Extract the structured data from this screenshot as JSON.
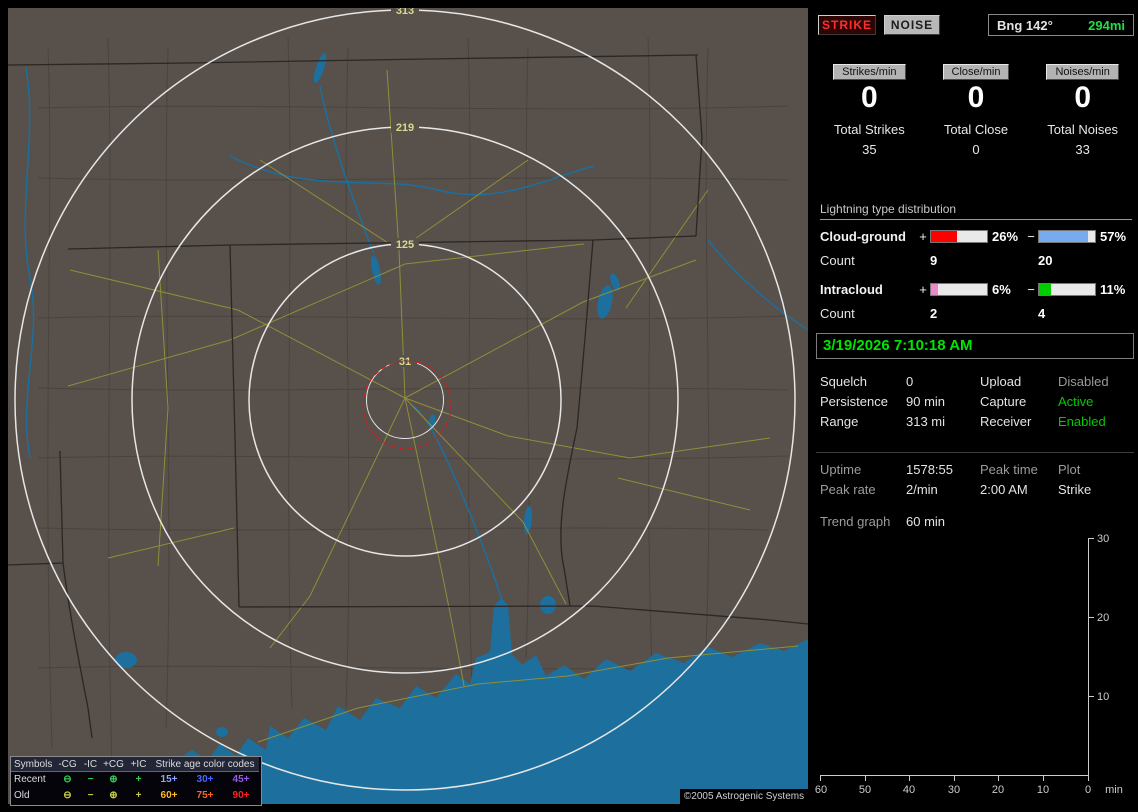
{
  "map": {
    "rings": [
      "313",
      "219",
      "125",
      "31"
    ],
    "copyright": "©2005 Astrogenic Systems",
    "legend": {
      "sym_header": "Symbols",
      "age_header": "Strike age color codes",
      "cols": [
        "-CG",
        "-IC",
        "+CG",
        "+IC"
      ],
      "rows": [
        {
          "label": "Recent",
          "sym_style": "color:#33cc55",
          "s0": "⊖",
          "s1": "−",
          "s2": "⊕",
          "s3": "+",
          "a0": "15+",
          "a0s": "color:#8fa8ff",
          "a1": "30+",
          "a1s": "color:#4a66ff",
          "a2": "45+",
          "a2s": "color:#a055ee"
        },
        {
          "label": "Old",
          "sym_style": "color:#cccc44",
          "s0": "⊖",
          "s1": "−",
          "s2": "⊕",
          "s3": "+",
          "a0": "60+",
          "a0s": "color:#ffbb22",
          "a1": "75+",
          "a1s": "color:#ff6622",
          "a2": "90+",
          "a2s": "color:#ff2222"
        }
      ]
    }
  },
  "header": {
    "strike": "STRIKE",
    "noise": "NOISE",
    "bearing_label": "Bng 142°",
    "bearing_value": "294mi"
  },
  "stats": {
    "columns": [
      {
        "rate_label": "Strikes/min",
        "rate": "0",
        "total_label": "Total Strikes",
        "total": "35"
      },
      {
        "rate_label": "Close/min",
        "rate": "0",
        "total_label": "Total Close",
        "total": "0"
      },
      {
        "rate_label": "Noises/min",
        "rate": "0",
        "total_label": "Total Noises",
        "total": "33"
      }
    ]
  },
  "distribution": {
    "title": "Lightning type distribution",
    "count_label": "Count",
    "rows": [
      {
        "label": "Cloud-ground",
        "plus_sign": "+",
        "minus_sign": "−",
        "plus_pct": "26%",
        "minus_pct": "57%",
        "plus_count": "9",
        "minus_count": "20",
        "plus_style": "width:46%;background:#ff0000",
        "minus_style": "width:88%;background:#77aaee"
      },
      {
        "label": "Intracloud",
        "plus_sign": "+",
        "minus_sign": "−",
        "plus_pct": "6%",
        "minus_pct": "11%",
        "plus_count": "2",
        "minus_count": "4",
        "plus_style": "width:12%;background:#ee88cc",
        "minus_style": "width:22%;background:#00cc00"
      }
    ]
  },
  "status": {
    "datetime": "3/19/2026 7:10:18 AM",
    "rows": [
      {
        "l1": "Squelch",
        "v1": "0",
        "l2": "Upload",
        "v2": "Disabled",
        "v2_style": "color:#9a9a9a"
      },
      {
        "l1": "Persistence",
        "v1": "90 min",
        "l2": "Capture",
        "v2": "Active",
        "v2_style": "color:#00cc00"
      },
      {
        "l1": "Range",
        "v1": "313 mi",
        "l2": "Receiver",
        "v2": "Enabled",
        "v2_style": "color:#00cc00"
      }
    ]
  },
  "info": {
    "uptime_label": "Uptime",
    "uptime": "1578:55",
    "peaktime_label": "Peak time",
    "plot_label": "Plot",
    "peakrate_label": "Peak rate",
    "peakrate": "2/min",
    "peaktime": "2:00 AM",
    "plot": "Strike",
    "trend_label": "Trend graph",
    "trend_value": "60 min"
  },
  "trend": {
    "y_ticks": [
      "30",
      "20",
      "10"
    ],
    "x_ticks": [
      "60",
      "50",
      "40",
      "30",
      "20",
      "10",
      "0"
    ],
    "unit": "min"
  }
}
